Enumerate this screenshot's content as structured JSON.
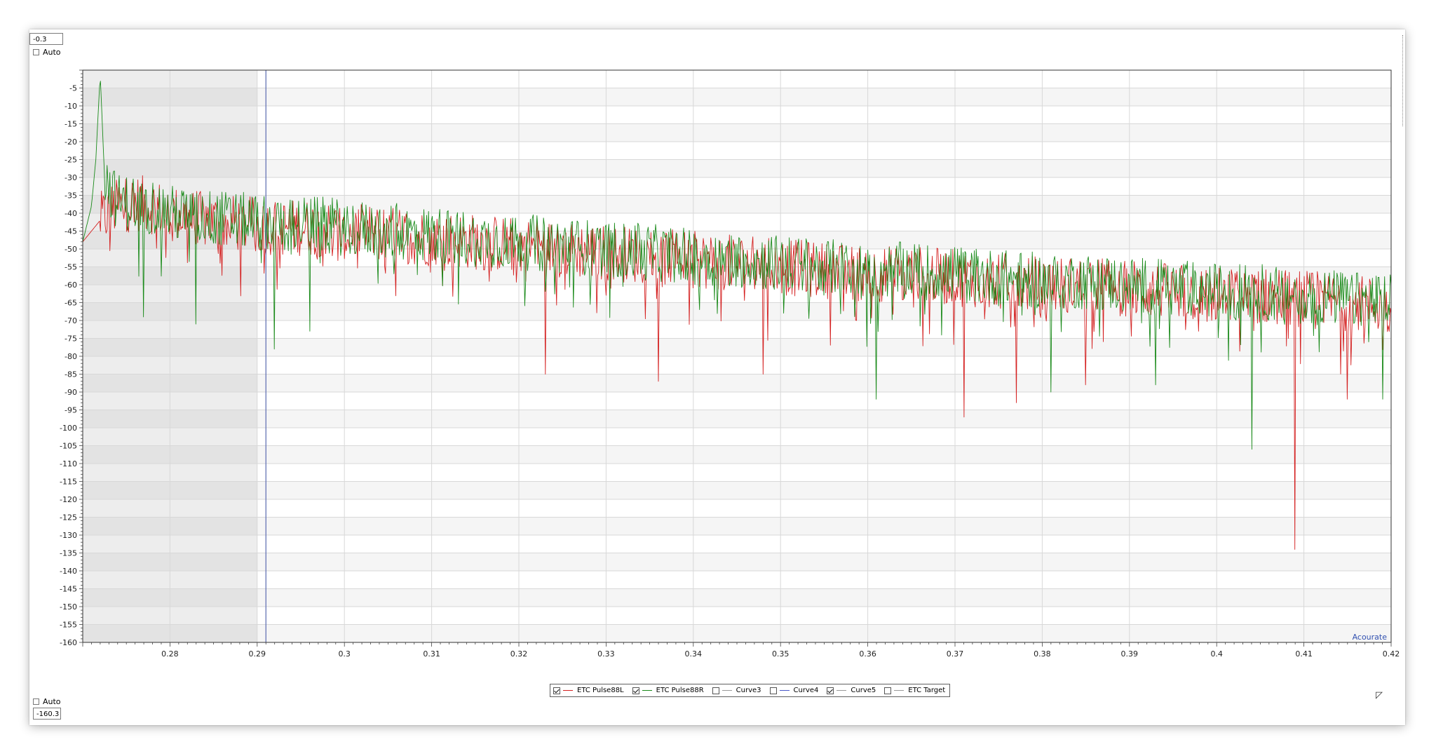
{
  "y_axis_controls": {
    "max_value": "-0.3",
    "max_auto_label": "Auto",
    "min_auto_label": "Auto",
    "min_value": "-160.3"
  },
  "accuracy_label": "Acourate",
  "legend": {
    "items": [
      {
        "label": "ETC Pulse88L",
        "checked": true,
        "color": "#d42020"
      },
      {
        "label": "ETC Pulse88R",
        "checked": true,
        "color": "#1a8a1a"
      },
      {
        "label": "Curve3",
        "checked": false,
        "color": "#9a9a9a"
      },
      {
        "label": "Curve4",
        "checked": false,
        "color": "#4a58c8"
      },
      {
        "label": "Curve5",
        "checked": true,
        "color": "#9a9a9a"
      },
      {
        "label": "ETC Target",
        "checked": false,
        "color": "#9a9a9a"
      }
    ]
  },
  "chart_data": {
    "type": "line",
    "title": "",
    "xlabel": "",
    "ylabel": "",
    "xlim": [
      0.27,
      0.42
    ],
    "ylim": [
      -160,
      0
    ],
    "x_ticks": [
      0.28,
      0.29,
      0.3,
      0.31,
      0.32,
      0.33,
      0.34,
      0.35,
      0.36,
      0.37,
      0.38,
      0.39,
      0.4,
      0.41,
      0.42
    ],
    "y_ticks": [
      -5,
      -10,
      -15,
      -20,
      -25,
      -30,
      -35,
      -40,
      -45,
      -50,
      -55,
      -60,
      -65,
      -70,
      -75,
      -80,
      -85,
      -90,
      -95,
      -100,
      -105,
      -110,
      -115,
      -120,
      -125,
      -130,
      -135,
      -140,
      -145,
      -150,
      -155,
      -160
    ],
    "grid": true,
    "shaded_region": [
      0.27,
      0.29
    ],
    "cursor_x": 0.291,
    "series": [
      {
        "name": "ETC Pulse88L",
        "color": "#d42020",
        "x": [
          0.27,
          0.272,
          0.274,
          0.276,
          0.278,
          0.28,
          0.284,
          0.288,
          0.292,
          0.296,
          0.3,
          0.305,
          0.31,
          0.315,
          0.32,
          0.325,
          0.33,
          0.335,
          0.34,
          0.345,
          0.35,
          0.355,
          0.36,
          0.365,
          0.37,
          0.375,
          0.38,
          0.385,
          0.39,
          0.395,
          0.4,
          0.405,
          0.41,
          0.415,
          0.42
        ],
        "y": [
          -48,
          -42,
          -38,
          -37,
          -38,
          -40,
          -42,
          -43,
          -44,
          -44,
          -45,
          -46,
          -47,
          -48,
          -49,
          -50,
          -51,
          -52,
          -53,
          -54,
          -55,
          -56,
          -57,
          -57,
          -58,
          -59,
          -60,
          -60,
          -61,
          -62,
          -63,
          -63,
          -64,
          -65,
          -66
        ],
        "spikes": [
          [
            0.323,
            -85
          ],
          [
            0.336,
            -87
          ],
          [
            0.348,
            -85
          ],
          [
            0.371,
            -97
          ],
          [
            0.377,
            -93
          ],
          [
            0.385,
            -88
          ],
          [
            0.409,
            -134
          ],
          [
            0.415,
            -92
          ]
        ]
      },
      {
        "name": "ETC Pulse88R",
        "color": "#1a8a1a",
        "x": [
          0.27,
          0.271,
          0.2715,
          0.272,
          0.2725,
          0.274,
          0.276,
          0.278,
          0.28,
          0.284,
          0.288,
          0.292,
          0.296,
          0.3,
          0.305,
          0.31,
          0.315,
          0.32,
          0.325,
          0.33,
          0.335,
          0.34,
          0.345,
          0.35,
          0.355,
          0.36,
          0.365,
          0.37,
          0.375,
          0.38,
          0.385,
          0.39,
          0.395,
          0.4,
          0.405,
          0.41,
          0.415,
          0.42
        ],
        "y": [
          -48,
          -38,
          -25,
          -1,
          -30,
          -37,
          -37,
          -38,
          -40,
          -41,
          -42,
          -43,
          -43,
          -44,
          -45,
          -46,
          -47,
          -48,
          -49,
          -50,
          -51,
          -52,
          -53,
          -54,
          -55,
          -56,
          -56,
          -57,
          -58,
          -59,
          -59,
          -60,
          -61,
          -62,
          -62,
          -63,
          -64,
          -65
        ],
        "spikes": [
          [
            0.277,
            -69
          ],
          [
            0.283,
            -71
          ],
          [
            0.292,
            -78
          ],
          [
            0.296,
            -73
          ],
          [
            0.361,
            -92
          ],
          [
            0.381,
            -90
          ],
          [
            0.393,
            -88
          ],
          [
            0.404,
            -106
          ],
          [
            0.419,
            -92
          ]
        ]
      }
    ]
  }
}
